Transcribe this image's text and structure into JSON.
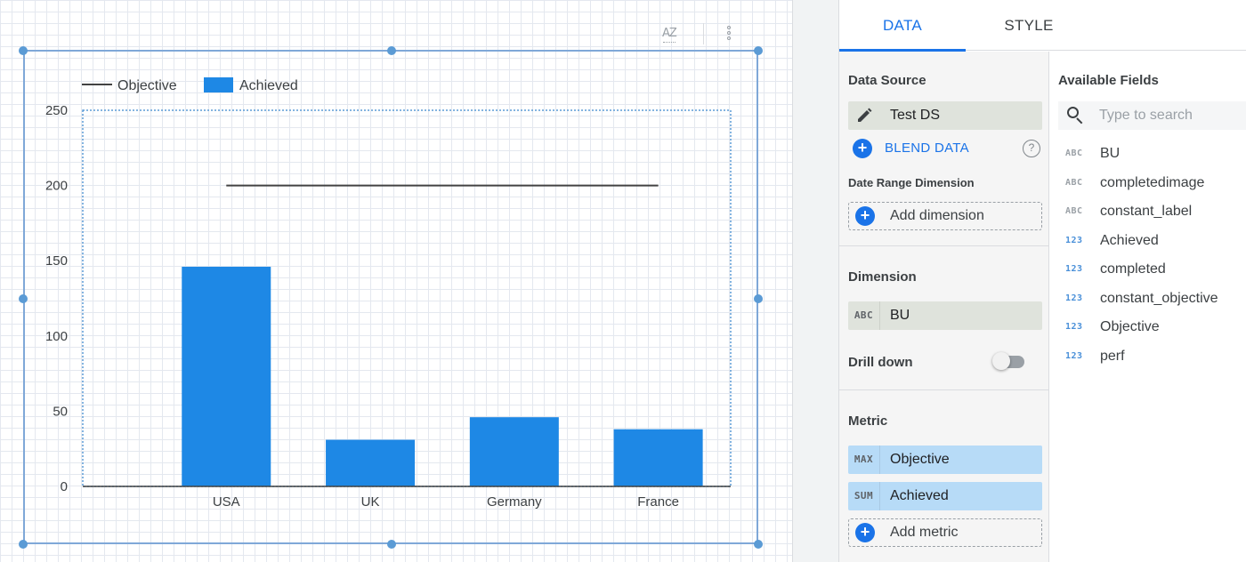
{
  "chart": {
    "legend": {
      "line_label": "Objective",
      "bar_label": "Achieved"
    },
    "toolbar": {
      "sort_icon": "sort-az-icon",
      "sort_text": "AZ",
      "menu_icon": "kebab-menu-icon"
    }
  },
  "chart_data": {
    "type": "bar",
    "categories": [
      "USA",
      "UK",
      "Germany",
      "France"
    ],
    "series": [
      {
        "name": "Achieved",
        "kind": "bar",
        "values": [
          146,
          31,
          46,
          38
        ],
        "color": "#1e88e5"
      },
      {
        "name": "Objective",
        "kind": "line",
        "values": [
          200,
          200,
          200,
          200
        ],
        "color": "#424242"
      }
    ],
    "yticks": [
      0,
      50,
      100,
      150,
      200,
      250
    ],
    "ylim": [
      0,
      250
    ],
    "title": "",
    "xlabel": "",
    "ylabel": "",
    "legend_position": "top-left",
    "grid": false
  },
  "panel": {
    "tabs": [
      {
        "label": "DATA",
        "active": true
      },
      {
        "label": "STYLE",
        "active": false
      }
    ],
    "data_source": {
      "title": "Data Source",
      "name": "Test DS",
      "blend_label": "BLEND DATA",
      "help_icon": "?"
    },
    "date_range": {
      "title": "Date Range Dimension",
      "add_label": "Add dimension"
    },
    "dimension": {
      "title": "Dimension",
      "type_tag": "ABC",
      "name": "BU"
    },
    "drill_down": {
      "label": "Drill down",
      "enabled": false
    },
    "metric": {
      "title": "Metric",
      "items": [
        {
          "agg": "MAX",
          "name": "Objective"
        },
        {
          "agg": "SUM",
          "name": "Achieved"
        }
      ],
      "add_label": "Add metric"
    },
    "available_fields": {
      "title": "Available Fields",
      "search_placeholder": "Type to search",
      "fields": [
        {
          "type": "ABC",
          "name": "BU"
        },
        {
          "type": "ABC",
          "name": "completedimage"
        },
        {
          "type": "ABC",
          "name": "constant_label"
        },
        {
          "type": "123",
          "name": "Achieved"
        },
        {
          "type": "123",
          "name": "completed"
        },
        {
          "type": "123",
          "name": "constant_objective"
        },
        {
          "type": "123",
          "name": "Objective"
        },
        {
          "type": "123",
          "name": "perf"
        }
      ]
    }
  }
}
